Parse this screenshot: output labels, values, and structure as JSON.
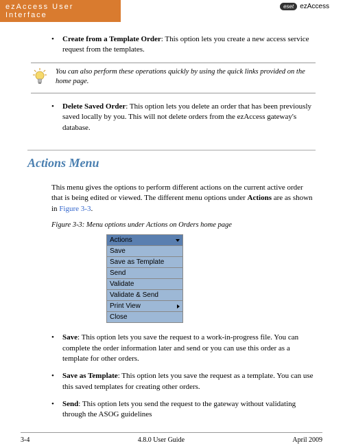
{
  "header": {
    "banner": "ezAccess User Interface",
    "logo_badge": "eset",
    "logo_text": "ezAccess"
  },
  "bullets_top": {
    "create_template_bold": "Create from a Template Order",
    "create_template_rest": ": This option lets you create a new access service request from the templates.",
    "delete_saved_bold": "Delete Saved Order",
    "delete_saved_rest": ": This option lets you delete an order that has been previously saved locally by you. This will not delete orders from the ezAccess gateway's database."
  },
  "tip": {
    "prefix": "You can also perform these operations quickly by using the quick links ",
    "italic": "provided on the home page."
  },
  "section": {
    "heading": "Actions Menu",
    "para_prefix": "This menu gives the options to perform different actions on the current active order that is being edited or viewed. The different menu options under ",
    "para_bold": "Actions",
    "para_mid": " are as shown in ",
    "para_link": "Figure 3-3",
    "para_end": ".",
    "figure_caption": "Figure 3-3:  Menu options under Actions on Orders home page"
  },
  "menu": {
    "head": "Actions",
    "items": [
      "Save",
      "Save as Template",
      "Send",
      "Validate",
      "Validate & Send",
      "Print View",
      "Close"
    ],
    "has_submenu_index": 5
  },
  "bullets_bottom": {
    "save_bold": "Save",
    "save_rest": ": This option lets you save the request to a work-in-progress file. You can complete the order information later and send or you can use this order as a template for other orders.",
    "save_template_bold": "Save as Template",
    "save_template_rest": ": This option lets you save the request as a template. You can use this saved templates for creating other orders.",
    "send_bold": "Send",
    "send_rest": ": This option lets you send the request to the gateway without validating through the ASOG guidelines"
  },
  "footer": {
    "left": "3-4",
    "center": "4.8.0 User Guide",
    "right": "April 2009"
  }
}
